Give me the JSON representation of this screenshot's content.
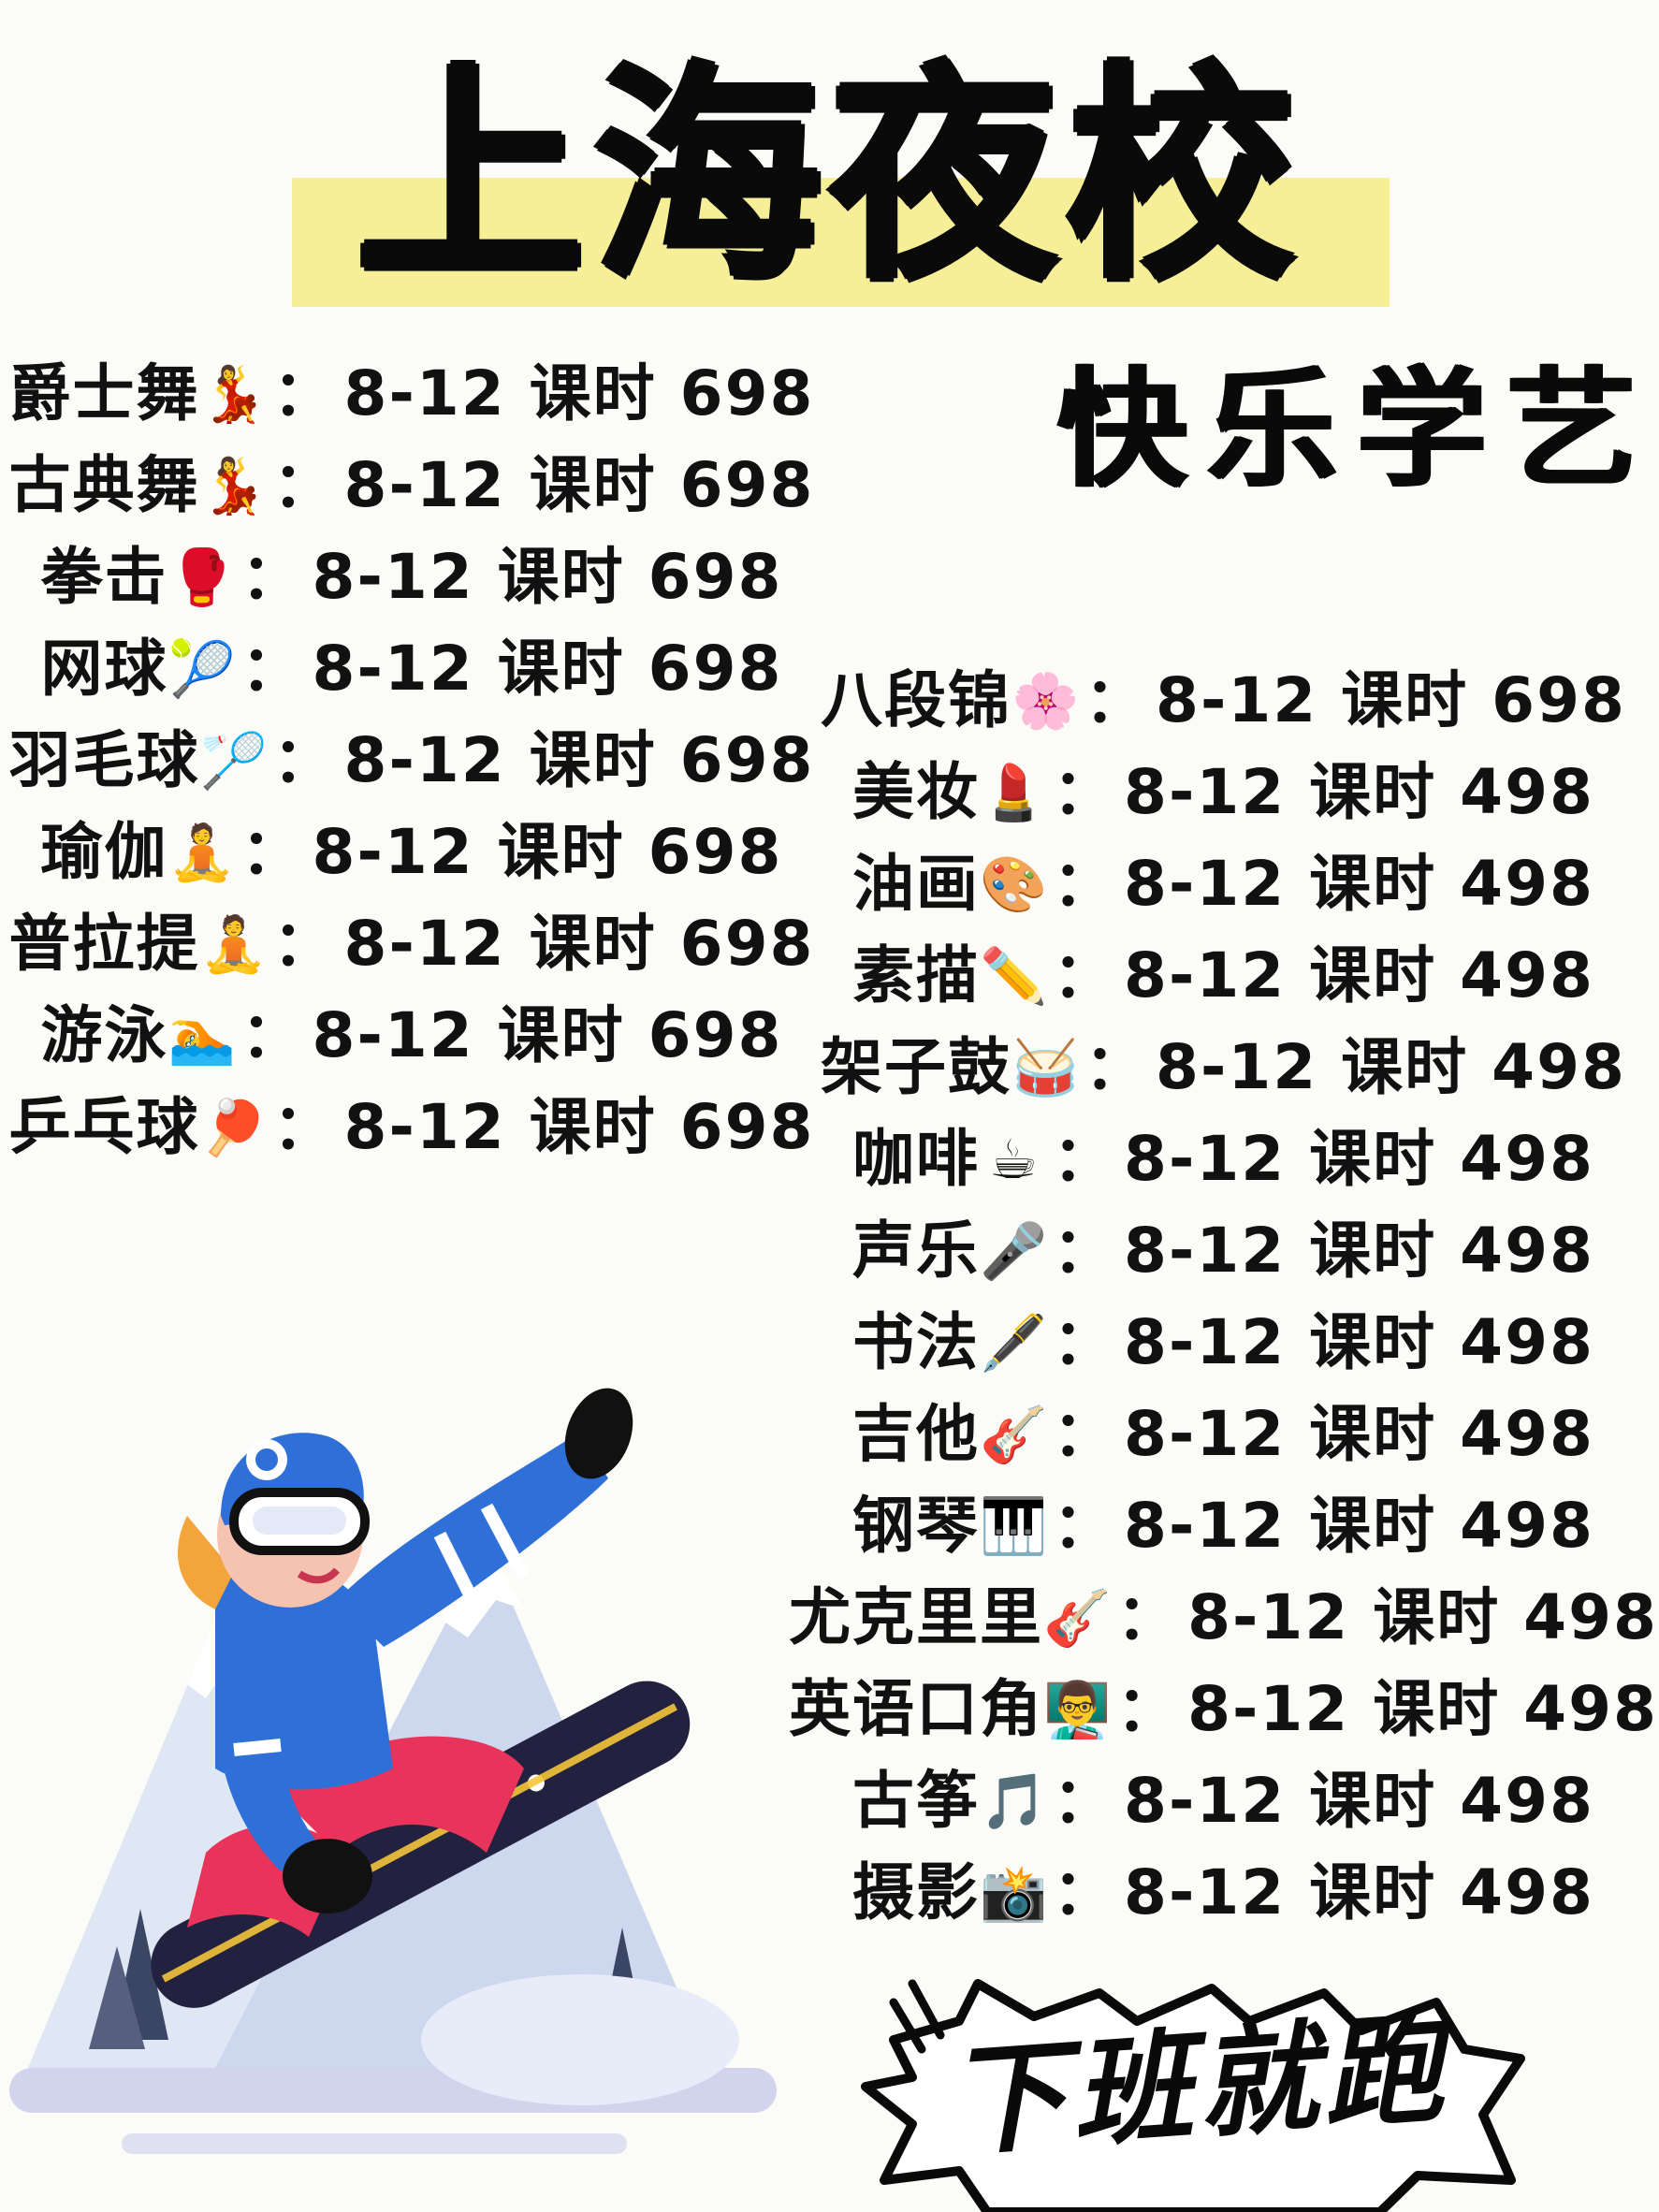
{
  "header": {
    "title": "上海夜校",
    "subtitle": "快乐学艺"
  },
  "courses_left": [
    {
      "name": "爵士舞",
      "emoji": "💃",
      "sep": "：",
      "price": "8-12 课时 698"
    },
    {
      "name": "古典舞",
      "emoji": "💃",
      "sep": "：",
      "price": "8-12 课时 698"
    },
    {
      "name": "拳击",
      "emoji": "🥊",
      "sep": "：",
      "price": "8-12 课时 698"
    },
    {
      "name": "网球",
      "emoji": "🎾",
      "sep": "：",
      "price": "8-12 课时 698"
    },
    {
      "name": "羽毛球",
      "emoji": "🏸",
      "sep": "：",
      "price": "8-12 课时 698"
    },
    {
      "name": "瑜伽",
      "emoji": "🧘",
      "sep": "：",
      "price": "8-12 课时 698"
    },
    {
      "name": "普拉提",
      "emoji": "🧘",
      "sep": "：",
      "price": "8-12 课时 698"
    },
    {
      "name": "游泳",
      "emoji": "🏊",
      "sep": "：",
      "price": "8-12 课时 698"
    },
    {
      "name": "乒乓球",
      "emoji": "🏓",
      "sep": "：",
      "price": "8-12 课时 698"
    }
  ],
  "courses_right": [
    {
      "name": "八段锦",
      "emoji": "🌸",
      "sep": "：",
      "price": "8-12 课时 698"
    },
    {
      "name": "美妆",
      "emoji": "💄",
      "sep": "：",
      "price": "8-12 课时 498"
    },
    {
      "name": "油画",
      "emoji": "🎨",
      "sep": "：",
      "price": "8-12 课时 498"
    },
    {
      "name": "素描",
      "emoji": "✏️",
      "sep": "：",
      "price": "8-12 课时 498"
    },
    {
      "name": "架子鼓",
      "emoji": "🥁",
      "sep": "：",
      "price": "8-12 课时 498"
    },
    {
      "name": "咖啡",
      "emoji": "☕",
      "sep": "：",
      "price": "8-12 课时 498"
    },
    {
      "name": "声乐",
      "emoji": "🎤",
      "sep": "：",
      "price": "8-12 课时 498"
    },
    {
      "name": "书法",
      "emoji": "🖋️",
      "sep": "：",
      "price": "8-12 课时 498"
    },
    {
      "name": "吉他",
      "emoji": "🎸",
      "sep": "：",
      "price": "8-12 课时 498"
    },
    {
      "name": "钢琴",
      "emoji": "🎹",
      "sep": "：",
      "price": "8-12 课时 498"
    },
    {
      "name": "尤克里里",
      "emoji": "🎸",
      "sep": "：",
      "price": "8-12 课时 498"
    },
    {
      "name": "英语口角",
      "emoji": "👨‍🏫",
      "sep": "：",
      "price": "8-12 课时 498"
    },
    {
      "name": "古筝",
      "emoji": "🎵",
      "sep": "：",
      "price": "8-12 课时 498"
    },
    {
      "name": "摄影",
      "emoji": "📸",
      "sep": "：",
      "price": "8-12 课时 498"
    }
  ],
  "sticker": {
    "text": "下班就跑"
  },
  "icons": {
    "illustration": "snowboarder-illustration",
    "sticker_shape": "burst-speech-bubble"
  },
  "colors": {
    "title_highlight": "#f7ef98",
    "jacket_blue": "#2f6fd8",
    "pants_red": "#e8345a",
    "board_navy": "#22213f"
  }
}
